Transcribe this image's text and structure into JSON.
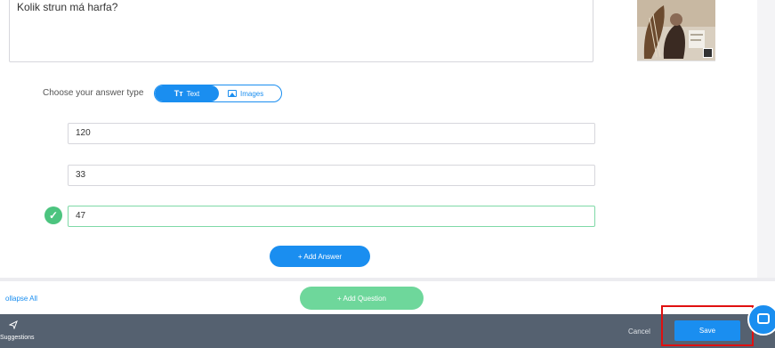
{
  "question": {
    "text": "Kolik strun má harfa?"
  },
  "answer_type": {
    "label": "Choose your answer type",
    "options": [
      {
        "glyph": "Tт",
        "label": "Text",
        "selected": true
      },
      {
        "label": "Images",
        "selected": false
      }
    ]
  },
  "answers": [
    {
      "value": "120",
      "correct": false
    },
    {
      "value": "33",
      "correct": false
    },
    {
      "value": "47",
      "correct": true
    }
  ],
  "buttons": {
    "add_answer": "+ Add Answer",
    "add_question": "+ Add Question",
    "collapse_all": "ollapse All",
    "cancel": "Cancel",
    "save": "Save"
  },
  "footer": {
    "suggestions": "Suggestions"
  },
  "icons": {
    "check": "check-icon",
    "send": "send-icon",
    "chat": "chat-icon",
    "text_type": "text-type-icon",
    "image_type": "image-icon"
  },
  "colors": {
    "primary": "#1a8ef0",
    "success": "#4cc47f",
    "add_question": "#6ed79b",
    "footer": "#556170",
    "highlight": "#e01010"
  }
}
